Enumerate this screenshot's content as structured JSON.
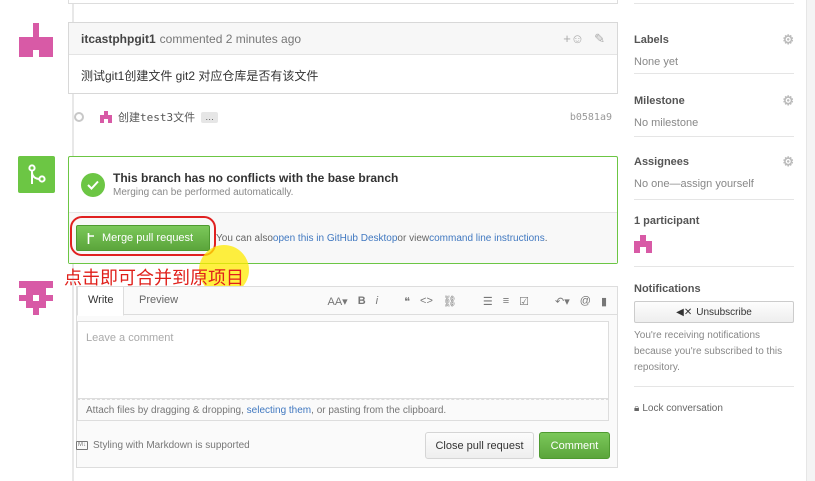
{
  "comment": {
    "author": "itcastphpgit1",
    "meta": "commented 2 minutes ago",
    "body": "测试git1创建文件 git2 对应仓库是否有该文件",
    "reaction_icon": "smiley-plus-icon",
    "edit_icon": "pencil-icon"
  },
  "commit": {
    "message": "创建test3文件",
    "ellipsis": "…",
    "sha": "b0581a9"
  },
  "merge": {
    "title": "This branch has no conflicts with the base branch",
    "subtitle": "Merging can be performed automatically.",
    "button_label": "Merge pull request",
    "also_text": "You can also ",
    "desktop_link": "open this in GitHub Desktop",
    "or_text": " or view ",
    "cli_link": "command line instructions",
    "period": "."
  },
  "annotation_text": "点击即可合并到原项目",
  "form": {
    "tab_write": "Write",
    "tab_preview": "Preview",
    "toolbar": {
      "heading": "AA▾",
      "bold": "B",
      "italic": "i",
      "quote": "❝",
      "code": "<>",
      "link": "⛓",
      "ul": "☰",
      "ol": "≡",
      "task": "☑",
      "reply": "↶▾",
      "mention": "@",
      "bookmark": "▮"
    },
    "placeholder": "Leave a comment",
    "attach_prefix": "Attach files by dragging & dropping, ",
    "attach_link": "selecting them",
    "attach_suffix": ", or pasting from the clipboard.",
    "md_note": "Styling with Markdown is supported",
    "md_icon": "M↓",
    "close_button": "Close pull request",
    "comment_button": "Comment"
  },
  "sidebar": {
    "labels_title": "Labels",
    "labels_value": "None yet",
    "milestone_title": "Milestone",
    "milestone_value": "No milestone",
    "assignees_title": "Assignees",
    "assignees_value": "No one—assign yourself",
    "participants_title": "1 participant",
    "notifications_title": "Notifications",
    "unsubscribe_label": "Unsubscribe",
    "notif_text": "You're receiving notifications because you're subscribed to this repository.",
    "lock_label": "Lock conversation"
  },
  "colors": {
    "identicon_pink": "#d85aa6",
    "merge_green": "#6cc644",
    "link_blue": "#4078c0",
    "annotation_red": "#e0201b"
  }
}
